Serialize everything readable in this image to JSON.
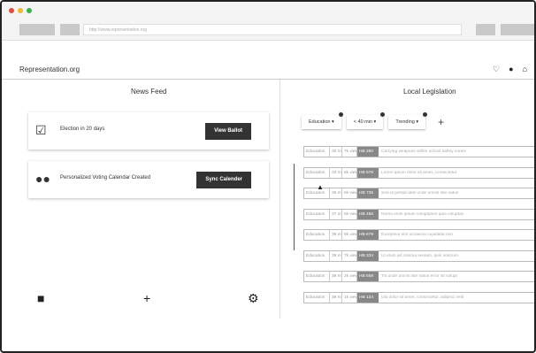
{
  "browser": {
    "url": "http://www.representation.org",
    "dot_colors": [
      "#e64a3b",
      "#f2b632",
      "#35b34a"
    ]
  },
  "app": {
    "brand": "Representation.org",
    "header_icons": [
      "bell-icon",
      "user-icon",
      "home-icon"
    ]
  },
  "news_feed": {
    "title": "News Feed",
    "cards": [
      {
        "icon": "check-box-icon",
        "text": "Election in 20 days",
        "button": "View Ballot"
      },
      {
        "icon": "people-icon",
        "text": "Personalized Voting Calendar Created",
        "button": "Sync Calender"
      }
    ],
    "bottom_icons": [
      "trash-icon",
      "plus-icon",
      "settings-icon"
    ]
  },
  "legislation": {
    "title": "Local Legislation",
    "filters": [
      "Education ▾",
      "< 40 min ▾",
      "Trending ▾"
    ],
    "rows": [
      {
        "category": "Education",
        "time": "30 min",
        "views": "7k views",
        "bill": "HB 280",
        "title": "Carrying weapons within school safety zones"
      },
      {
        "category": "Education",
        "time": "33 min",
        "views": "6k views",
        "bill": "HB 576",
        "title": "Lorem ipsum dolor sit amet, consectetur"
      },
      {
        "category": "Education",
        "time": "35 min",
        "views": "6k views",
        "bill": "HB 735",
        "title": "Sed ut perspiciatis unde omnis iste natus"
      },
      {
        "category": "Education",
        "time": "37 min",
        "views": "5k views",
        "bill": "HB 456",
        "title": "Nemo enim ipsum voluptatem quia voluptas"
      },
      {
        "category": "Education",
        "time": "38 min",
        "views": "8k views",
        "bill": "HB 679",
        "title": "Excepteur sint occaecat cupidatat non"
      },
      {
        "category": "Education",
        "time": "39 min",
        "views": "7k views",
        "bill": "HB 334",
        "title": "Ut enim ad minima veniam, quis nostrum"
      },
      {
        "category": "Education",
        "time": "39 min",
        "views": "2k views",
        "bill": "HB 568",
        "title": "Tis unde omnis iste natus error sit volupt"
      },
      {
        "category": "Education",
        "time": "39 min",
        "views": "1k views",
        "bill": "HB 134",
        "title": "Ula dolor sit amet, consectetur, adipisci velit"
      }
    ]
  }
}
